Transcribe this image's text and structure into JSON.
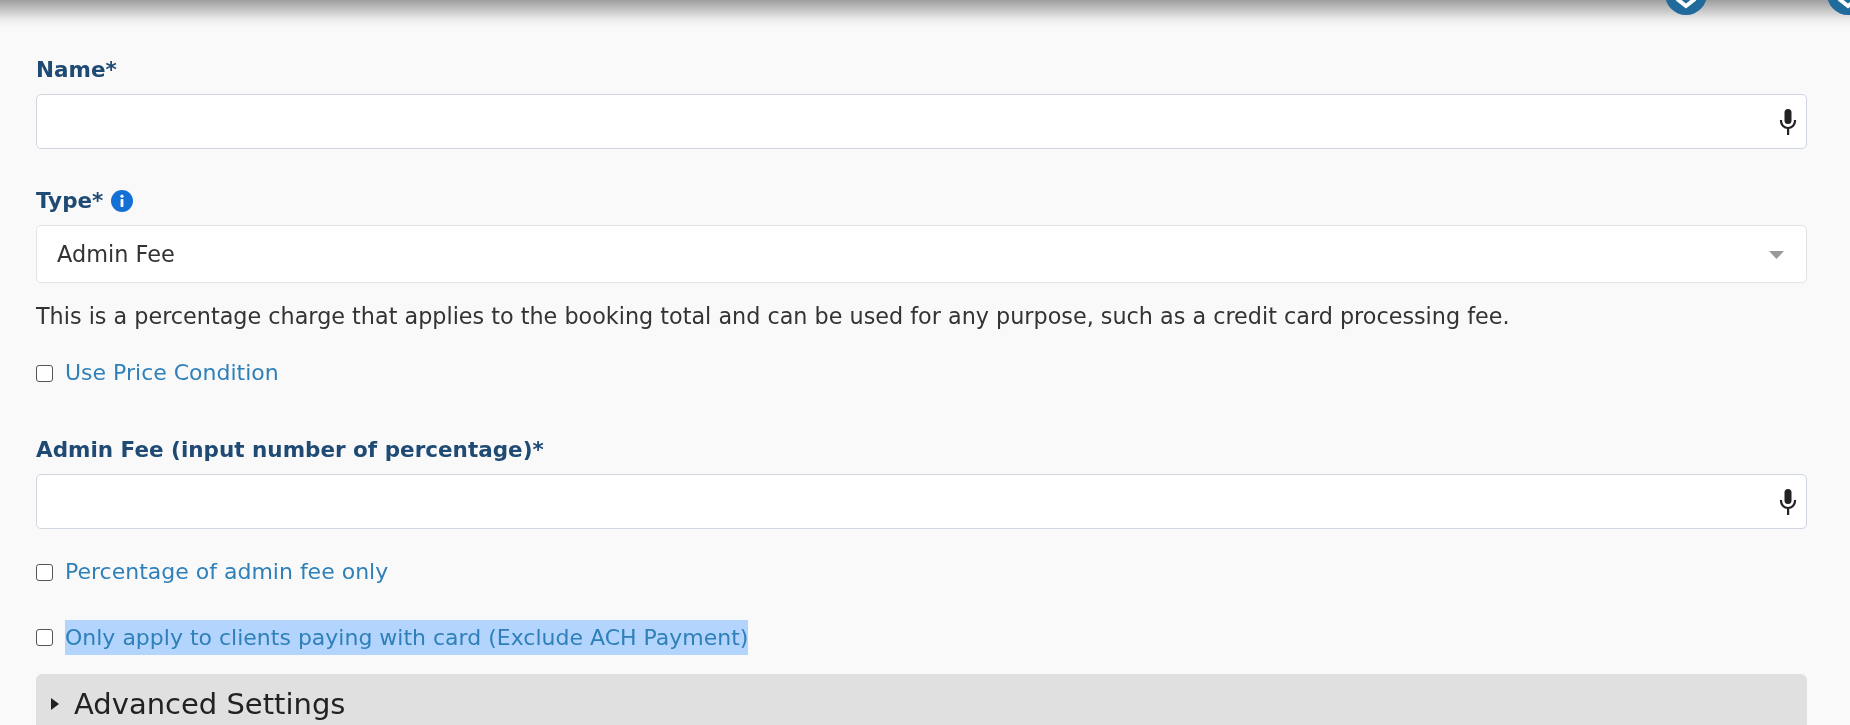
{
  "form": {
    "fields": [
      {
        "kind": "text",
        "label": "Name*"
      },
      {
        "kind": "select",
        "label": "Type*",
        "info": true,
        "value": "Admin Fee",
        "help": "This is a percentage charge that applies to the booking total and can be used for any purpose, such as a credit card processing fee."
      },
      {
        "kind": "checkbox",
        "label": "Use Price Condition",
        "checked": false,
        "highlighted": false
      },
      {
        "kind": "text",
        "label": "Admin Fee (input number of percentage)*"
      },
      {
        "kind": "checkbox",
        "label": "Percentage of admin fee only",
        "checked": false,
        "highlighted": false
      },
      {
        "kind": "checkbox",
        "label": "Only apply to clients paying with card (Exclude ACH Payment)",
        "checked": false,
        "highlighted": true
      }
    ]
  },
  "advanced": {
    "title": "Advanced Settings",
    "expanded": false
  }
}
